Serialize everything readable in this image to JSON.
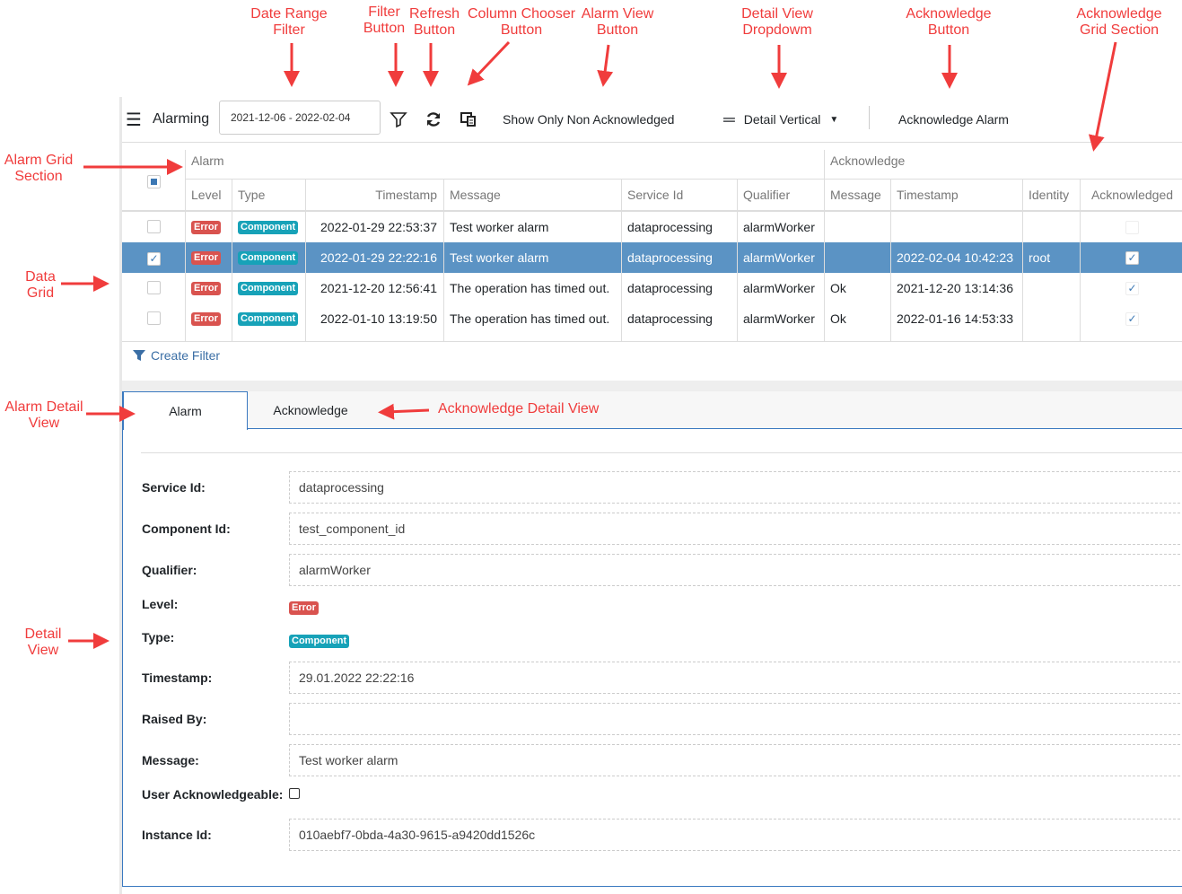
{
  "annotations": {
    "date_range_filter": "Date Range\nFilter",
    "filter_button": "Filter\nButton",
    "refresh_button": "Refresh\nButton",
    "column_chooser_button": "Column Chooser\nButton",
    "alarm_view_button": "Alarm View\nButton",
    "detail_view_dropdown": "Detail View\nDropdowm",
    "acknowledge_button": "Acknowledge\nButton",
    "acknowledge_grid_section": "Acknowledge\nGrid Section",
    "alarm_grid_section": "Alarm Grid\nSection",
    "data_grid": "Data\nGrid",
    "alarm_detail_view": "Alarm Detail\nView",
    "acknowledge_detail_view": "Acknowledge Detail View",
    "detail_view": "Detail\nView",
    "color": "#f03c3c"
  },
  "toolbar": {
    "title": "Alarming",
    "date_range": "2021-12-06 - 2022-02-04",
    "show_only_label": "Show Only Non Acknowledged",
    "detail_view": "Detail Vertical",
    "acknowledge_label": "Acknowledge Alarm"
  },
  "grid": {
    "groups": {
      "alarm": "Alarm",
      "acknowledge": "Acknowledge"
    },
    "columns": [
      "Level",
      "Type",
      "Timestamp",
      "Message",
      "Service Id",
      "Qualifier",
      "Message",
      "Timestamp",
      "Identity",
      "Acknowledged"
    ],
    "selected_color": "#5b93c4",
    "rows": [
      {
        "selected": false,
        "level": "Error",
        "type": "Component",
        "timestamp": "2022-01-29 22:53:37",
        "message": "Test worker alarm",
        "service_id": "dataprocessing",
        "qualifier": "alarmWorker",
        "ack_message": "",
        "ack_timestamp": "",
        "identity": "",
        "acknowledged": false
      },
      {
        "selected": true,
        "level": "Error",
        "type": "Component",
        "timestamp": "2022-01-29 22:22:16",
        "message": "Test worker alarm",
        "service_id": "dataprocessing",
        "qualifier": "alarmWorker",
        "ack_message": "",
        "ack_timestamp": "2022-02-04 10:42:23",
        "identity": "root",
        "acknowledged": true
      },
      {
        "selected": false,
        "level": "Error",
        "type": "Component",
        "timestamp": "2021-12-20 12:56:41",
        "message": "The operation has timed out.",
        "service_id": "dataprocessing",
        "qualifier": "alarmWorker",
        "ack_message": "Ok",
        "ack_timestamp": "2021-12-20 13:14:36",
        "identity": "",
        "acknowledged": true
      },
      {
        "selected": false,
        "level": "Error",
        "type": "Component",
        "timestamp": "2022-01-10 13:19:50",
        "message": "The operation has timed out.",
        "service_id": "dataprocessing",
        "qualifier": "alarmWorker",
        "ack_message": "Ok",
        "ack_timestamp": "2022-01-16 14:53:33",
        "identity": "",
        "acknowledged": true
      }
    ],
    "create_filter": "Create Filter"
  },
  "detail": {
    "tabs": [
      "Alarm",
      "Acknowledge"
    ],
    "service_id_label": "Service Id:",
    "service_id": "dataprocessing",
    "component_id_label": "Component Id:",
    "component_id": "test_component_id",
    "qualifier_label": "Qualifier:",
    "qualifier": "alarmWorker",
    "level_label": "Level:",
    "level": "Error",
    "type_label": "Type:",
    "type": "Component",
    "timestamp_label": "Timestamp:",
    "timestamp": "29.01.2022 22:22:16",
    "raised_by_label": "Raised By:",
    "raised_by": "",
    "message_label": "Message:",
    "message": "Test worker alarm",
    "user_ack_label": "User Acknowledgeable:",
    "user_ack": false,
    "instance_id_label": "Instance Id:",
    "instance_id": "010aebf7-0bda-4a30-9615-a9420dd1526c"
  }
}
